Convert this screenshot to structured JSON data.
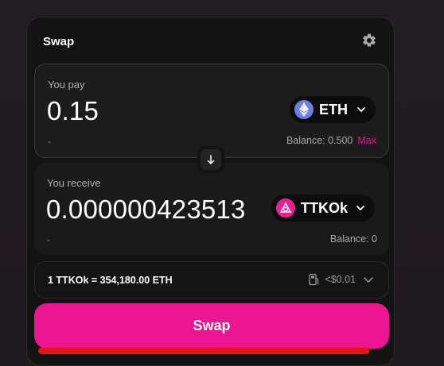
{
  "swap": {
    "title": "Swap",
    "pay": {
      "label": "You pay",
      "amount": "0.15",
      "usd_value": "-",
      "balance_text": "Balance: 0.500",
      "max_label": "Max",
      "token": {
        "symbol": "ETH",
        "icon": "ethereum-icon"
      }
    },
    "receive": {
      "label": "You receive",
      "amount": "0.000000423513",
      "usd_value": "-",
      "balance_text": "Balance: 0",
      "token": {
        "symbol": "TTKOk",
        "icon": "ttkok-token-icon"
      }
    },
    "rate": {
      "text": "1 TTKOk = 354,180.00 ETH",
      "gas_fee": "<$0.01"
    },
    "swap_button_label": "Swap"
  },
  "colors": {
    "accent": "#ec1592",
    "background": "#141314",
    "panel": "#1b1b1c",
    "eth_icon": "#6b7fe0",
    "ttkok_icon": "#e8208f",
    "error_line": "#e61515"
  }
}
